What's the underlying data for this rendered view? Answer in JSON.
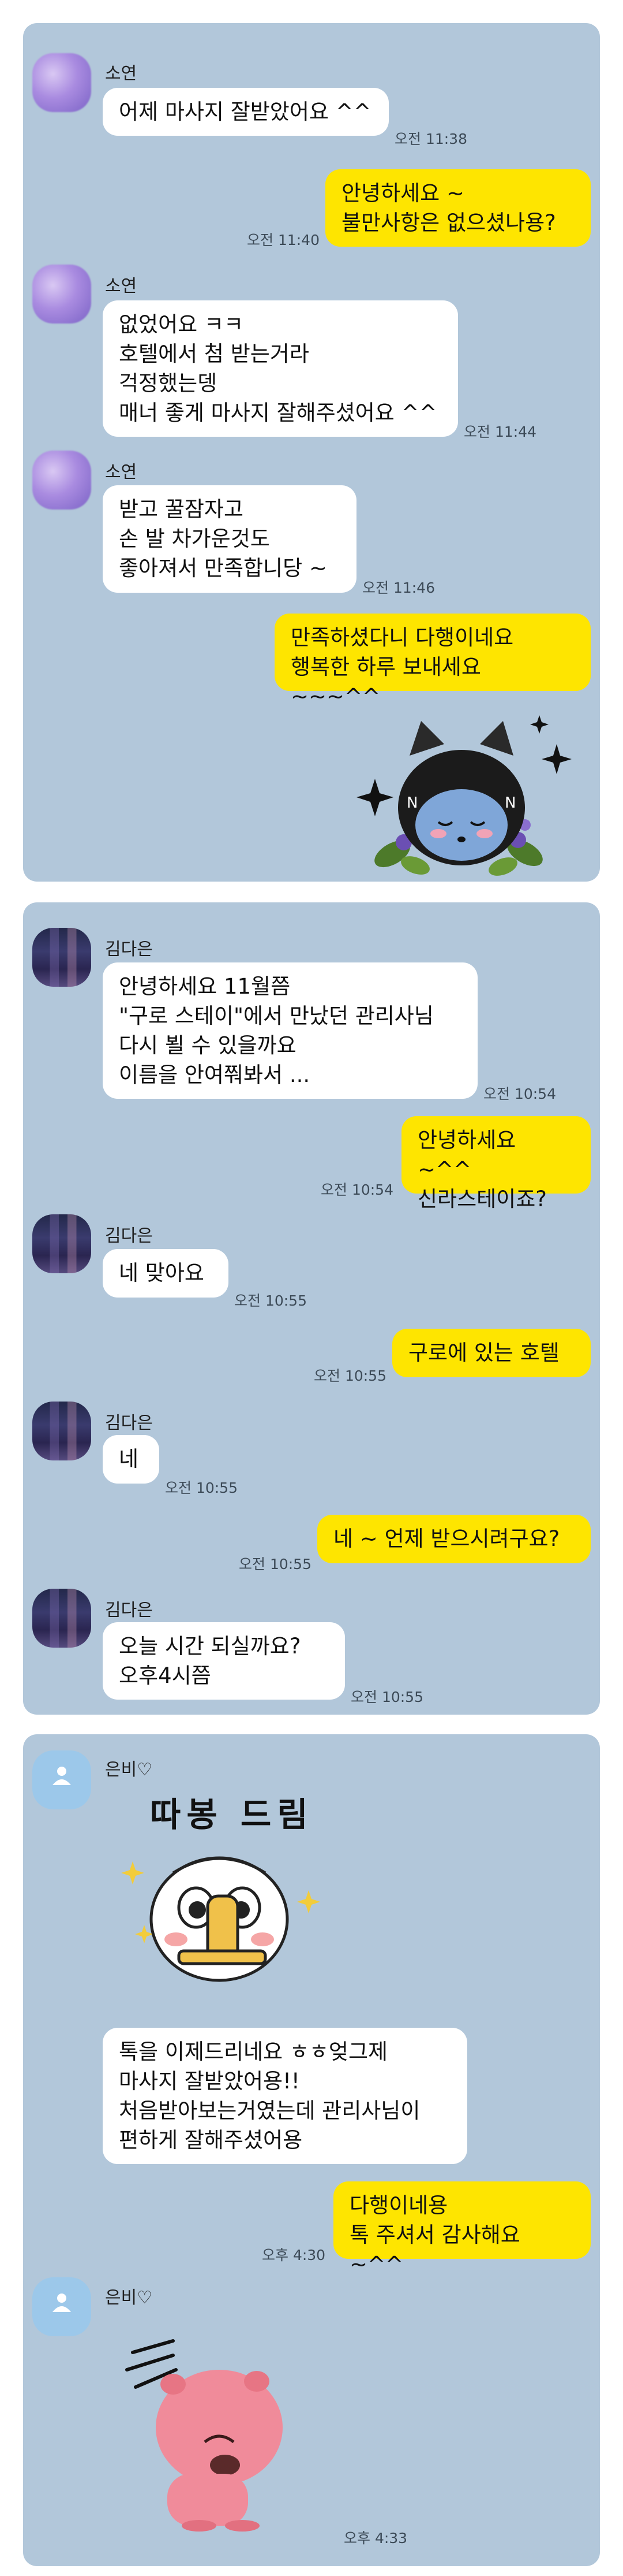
{
  "panels": [
    {
      "messages": [
        {
          "sender": "소연",
          "text": "어제 마사지 잘받았어요 ^^",
          "time": "오전 11:38"
        },
        {
          "sender": "me",
          "text": "안녕하세요 ~\n불만사항은 없으셨나용?",
          "time": "오전 11:40"
        },
        {
          "sender": "소연",
          "text": "없었어요 ㅋㅋ\n호텔에서 첨 받는거라\n걱정했는뎅\n매너 좋게 마사지 잘해주셨어요 ^^",
          "time": "오전 11:44"
        },
        {
          "sender": "소연",
          "text": "받고 꿀잠자고\n손 발 차가운것도\n좋아져서 만족합니당 ~",
          "time": "오전 11:46"
        },
        {
          "sender": "me",
          "text": "만족하셨다니 다행이네요\n행복한 하루 보내세요 ~~~^^",
          "time": ""
        }
      ],
      "sticker": "sparkle-cat-sticker"
    },
    {
      "messages": [
        {
          "sender": "김다은",
          "text": "안녕하세요 11월쯤\n\"구로 스테이\"에서 만났던 관리사님\n다시 뵐 수 있을까요\n이름을 안여쭤봐서 ...",
          "time": "오전 10:54"
        },
        {
          "sender": "me",
          "text": "안녕하세요 ~^^\n신라스테이죠?",
          "time": "오전 10:54"
        },
        {
          "sender": "김다은",
          "text": "네 맞아요",
          "time": "오전 10:55"
        },
        {
          "sender": "me",
          "text": "구로에 있는 호텔",
          "time": "오전 10:55"
        },
        {
          "sender": "김다은",
          "text": "네",
          "time": "오전 10:55"
        },
        {
          "sender": "me",
          "text": "네 ~ 언제 받으시려구요?",
          "time": "오전 10:55"
        },
        {
          "sender": "김다은",
          "text": "오늘  시간 되실까요?\n오후4시쯤",
          "time": "오전 10:55"
        }
      ]
    },
    {
      "messages": [
        {
          "sender": "은비♡",
          "text": "톡을 이제드리네요 ㅎㅎ엊그제\n마사지 잘받았어용!!\n처음받아보는거였는데 관리사님이\n편하게 잘해주셨어용",
          "time": ""
        },
        {
          "sender": "me",
          "text": "다행이네용\n톡 주셔서 감사해요 ~^^",
          "time": "오후 4:30"
        },
        {
          "sender": "은비♡",
          "text": "",
          "time": "오후 4:33"
        }
      ],
      "sticker_caption": "따봉 드림",
      "sticker_top": "thumbs-up-sticker",
      "sticker_bottom": "pink-beaver-sticker"
    }
  ],
  "colors": {
    "chat_background": "#b2c7da",
    "outgoing_bubble": "#fee500",
    "incoming_bubble": "#ffffff"
  }
}
